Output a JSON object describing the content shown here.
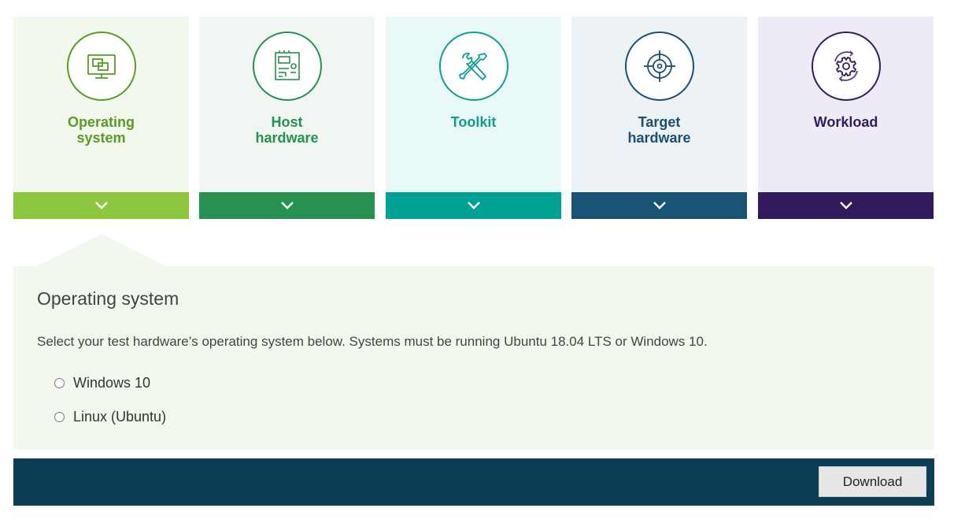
{
  "steps": [
    {
      "label_l1": "Operating",
      "label_l2": "system",
      "icon": "monitor-icon",
      "bg": "#f3f8ee",
      "accent": "#5a9a26",
      "bar": "#8dc63f"
    },
    {
      "label_l1": "Host",
      "label_l2": "hardware",
      "icon": "circuit-board-icon",
      "bg": "#f0f7f2",
      "accent": "#25914f",
      "bar": "#269150"
    },
    {
      "label_l1": "Toolkit",
      "label_l2": "",
      "icon": "tools-icon",
      "bg": "#e9f9f8",
      "accent": "#0f9d92",
      "bar": "#00a195"
    },
    {
      "label_l1": "Target",
      "label_l2": "hardware",
      "icon": "target-icon",
      "bg": "#ecf2f6",
      "accent": "#1b4f71",
      "bar": "#1a5475"
    },
    {
      "label_l1": "Workload",
      "label_l2": "",
      "icon": "gear-cycle-icon",
      "bg": "#eeebf6",
      "accent": "#341c5c",
      "bar": "#31195c"
    }
  ],
  "panel": {
    "title": "Operating system",
    "description": "Select your test hardware’s operating system below. Systems must be running Ubuntu 18.04 LTS or Windows 10.",
    "options": [
      "Windows 10",
      "Linux (Ubuntu)"
    ]
  },
  "footer": {
    "download_label": "Download"
  }
}
